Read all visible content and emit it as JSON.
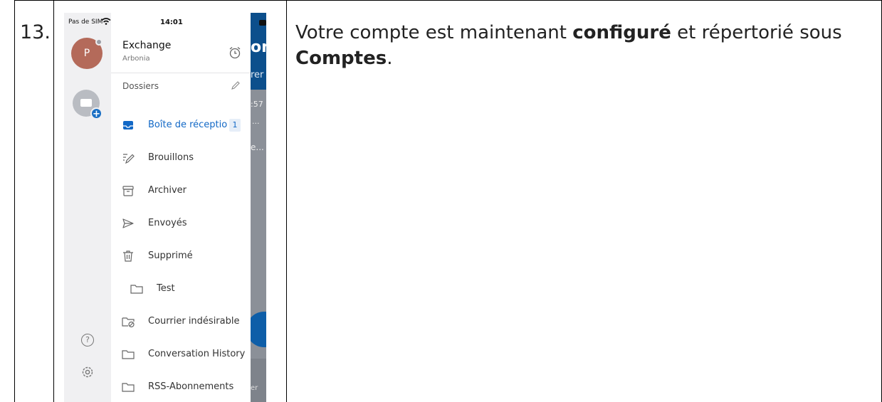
{
  "step": {
    "number": "13."
  },
  "description": {
    "part1": "Votre compte est maintenant ",
    "bold1": "configuré",
    "part2": " et répertorié sous ",
    "bold2": "Comptes",
    "part3": "."
  },
  "phone": {
    "status": {
      "carrier": "Pas de SIM",
      "time": "14:01"
    },
    "account": {
      "avatar_letter": "P",
      "name": "Exchange",
      "org": "Arbonia"
    },
    "folders_heading": "Dossiers",
    "folders": [
      {
        "label": "Boîte de réceptio",
        "count": "1",
        "icon": "inbox-icon"
      },
      {
        "label": "Brouillons",
        "icon": "drafts-icon"
      },
      {
        "label": "Archiver",
        "icon": "archive-icon"
      },
      {
        "label": "Envoyés",
        "icon": "sent-icon"
      },
      {
        "label": "Supprimé",
        "icon": "trash-icon"
      },
      {
        "label": "Test",
        "icon": "folder-icon"
      },
      {
        "label": "Courrier indésirable",
        "icon": "junk-folder-icon"
      },
      {
        "label": "Conversation History",
        "icon": "folder-icon"
      },
      {
        "label": "RSS-Abonnements",
        "icon": "folder-icon"
      }
    ],
    "background": {
      "title": "on",
      "subtitle": "rer",
      "time": ":57",
      "dots": "...",
      "preview": "e...",
      "bottom": "er"
    },
    "colors": {
      "accent": "#1268c6",
      "header": "#0c4f8c",
      "avatar": "#b46a5a"
    }
  }
}
